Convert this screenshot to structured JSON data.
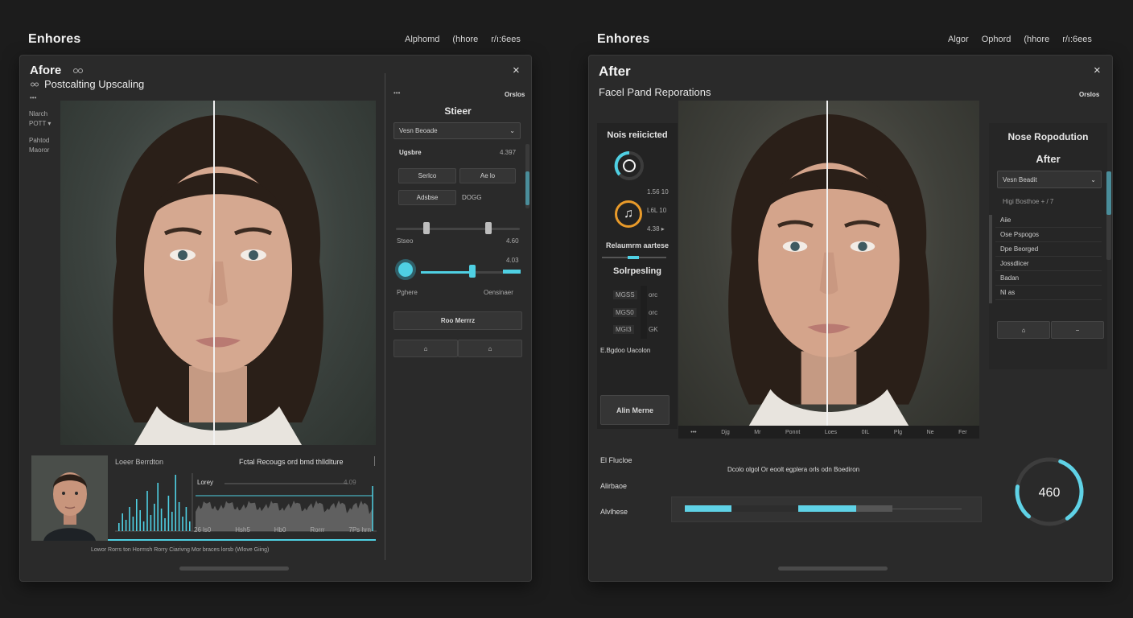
{
  "left": {
    "app_title": "Enhores",
    "menu": [
      "Alphomd",
      "(hhore",
      "r/ı:6ees"
    ],
    "window": {
      "title": "Afore",
      "title_icon": "link-icon",
      "subtitle": "Postcalting Upscaling",
      "subtitle_icon": "link-icon",
      "close_label": "×",
      "side_dots": "•••",
      "side_items": [
        "Nlarch",
        "POTT ▾",
        "Pahtod",
        "Maoror"
      ],
      "panel": {
        "dots": "•••",
        "top_right": "Orslos",
        "heading": "Stieer",
        "dropdown_value": "Vesn Beoade",
        "row_label": "Ugsbre",
        "row_value": "4.397",
        "buttons": [
          "Serlco",
          "Ae lo",
          "Adsbse",
          "DOGG"
        ],
        "slider_left": "Stseo",
        "slider_right": "4.60",
        "slider2_value": "4.03",
        "slider2_left": "Pghere",
        "slider2_right": "Oensinaer",
        "slider_position": 0.52,
        "wide_button": "Roo Merrrz",
        "icon_buttons": [
          "home-icon",
          "home-icon"
        ]
      },
      "bottom": {
        "thumb_label": "Loeer Berrdton",
        "right_label": "Fctal Recougs ord bmd thlldlture",
        "graph_label": "Lorey",
        "graph_value": "4.09",
        "ticks": [
          "26 ls0",
          "Hsh5",
          "Hb0",
          "Rorrr",
          "7Ps hrn"
        ],
        "caption": "Lowor Rorrs ton Hormsh Rorry Ciarivng Mor braces lorsb (Wlove Giing)"
      }
    }
  },
  "right": {
    "app_title": "Enhores",
    "menu": [
      "Algor",
      "Ophord",
      "(hhore",
      "r/ı:6ees"
    ],
    "window": {
      "title": "After",
      "close_label": "×",
      "subtitle": "Facel Pand Reporations",
      "top_right": "Orslos",
      "left_panel": {
        "heading": "Nois reiicicted",
        "value1": "1.56 10",
        "value2": "L6L 10",
        "value3": "4.38 ▸",
        "label2": "Relaumrm aartese",
        "heading2": "Solrpesling",
        "rows": [
          [
            "MGSS",
            "orc"
          ],
          [
            "MGS0",
            "orc"
          ],
          [
            "MGI3",
            "GK"
          ]
        ],
        "footer": "E.Bgdoo Uacolon",
        "button": "Alin Merne"
      },
      "strip": [
        "•••",
        "Djg",
        "Mr",
        "Ponnt",
        "Loes",
        "0IL",
        "Plg",
        "Ne",
        "Fer"
      ],
      "right_panel": {
        "heading": "Nose Ropodution",
        "subheading": "After",
        "dropdown_value": "Vesn Beadit",
        "line": "Higi Bosthoe + / 7",
        "list": [
          "Aiie",
          "Ose Pspogos",
          "Dpe Beorged",
          "Jossdlicer",
          "Badan",
          "Nl as"
        ],
        "icon_buttons": [
          "home-icon",
          "minus-icon"
        ]
      },
      "bottom": {
        "labels": [
          "El Flucloe",
          "Alirbaoe",
          "Alvlhese"
        ],
        "center_text": "Dcolo olgol Or eoolt egplera orls odn Boediron",
        "gauge_value": "460",
        "gauge_fraction": 0.35,
        "bar_segments": [
          {
            "from": 0.0,
            "to": 0.17,
            "color": "#5fd2e6"
          },
          {
            "from": 0.17,
            "to": 0.41,
            "color": "#2d2d2d"
          },
          {
            "from": 0.41,
            "to": 0.62,
            "color": "#5fd2e6"
          },
          {
            "from": 0.62,
            "to": 0.75,
            "color": "#555555"
          }
        ]
      }
    }
  },
  "colors": {
    "accent": "#4fd0e3",
    "orange": "#e89a2a",
    "bg": "#1c1c1c",
    "panel": "#2a2a2a"
  }
}
